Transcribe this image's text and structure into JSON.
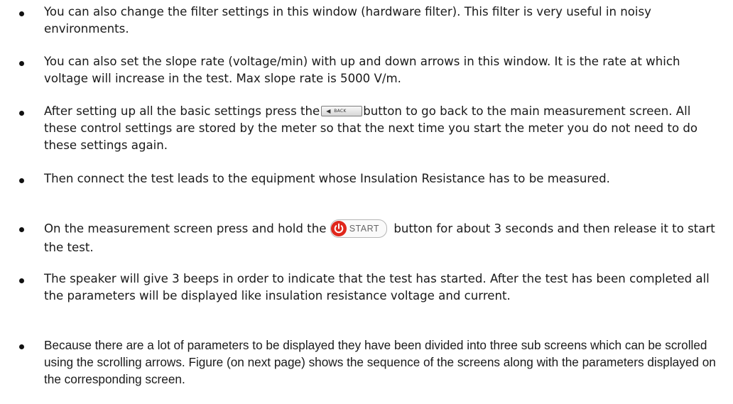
{
  "bullets": [
    {
      "text": "You can also change the filter settings in this window (hardware filter). This filter is very useful in noisy environments."
    },
    {
      "text": "You can also set the slope rate (voltage/min) with up and down arrows in this window. It is the rate at which voltage will increase in the test. Max slope rate is 5000 V/m."
    },
    {
      "before": "After setting up all the basic settings press the",
      "button_label": "BACK",
      "after": "button to go back to the main measurement screen. All these control settings are stored by the meter so that the next time you start the meter you do not need to do these settings again."
    },
    {
      "text": "Then connect the test leads to the equipment whose Insulation Resistance has to be measured."
    },
    {
      "before": "On the measurement screen press and hold the",
      "button_label": "START",
      "after": "button for about 3 seconds and then release it to start the test."
    },
    {
      "text": "The speaker will give 3 beeps in order to indicate that the test has started. After the test has been completed all the parameters will be displayed like insulation resistance voltage and current."
    },
    {
      "text": "Because there are a lot of parameters to be displayed they have been divided into three sub screens which can be scrolled using the scrolling arrows. Figure (on next page) shows the sequence of the screens along with the parameters displayed on the corresponding screen."
    }
  ],
  "icons": {
    "back_arrow": "left-triangle-icon",
    "power": "power-icon"
  },
  "colors": {
    "power_icon": "#e0271c",
    "text": "#1a1a1a"
  }
}
